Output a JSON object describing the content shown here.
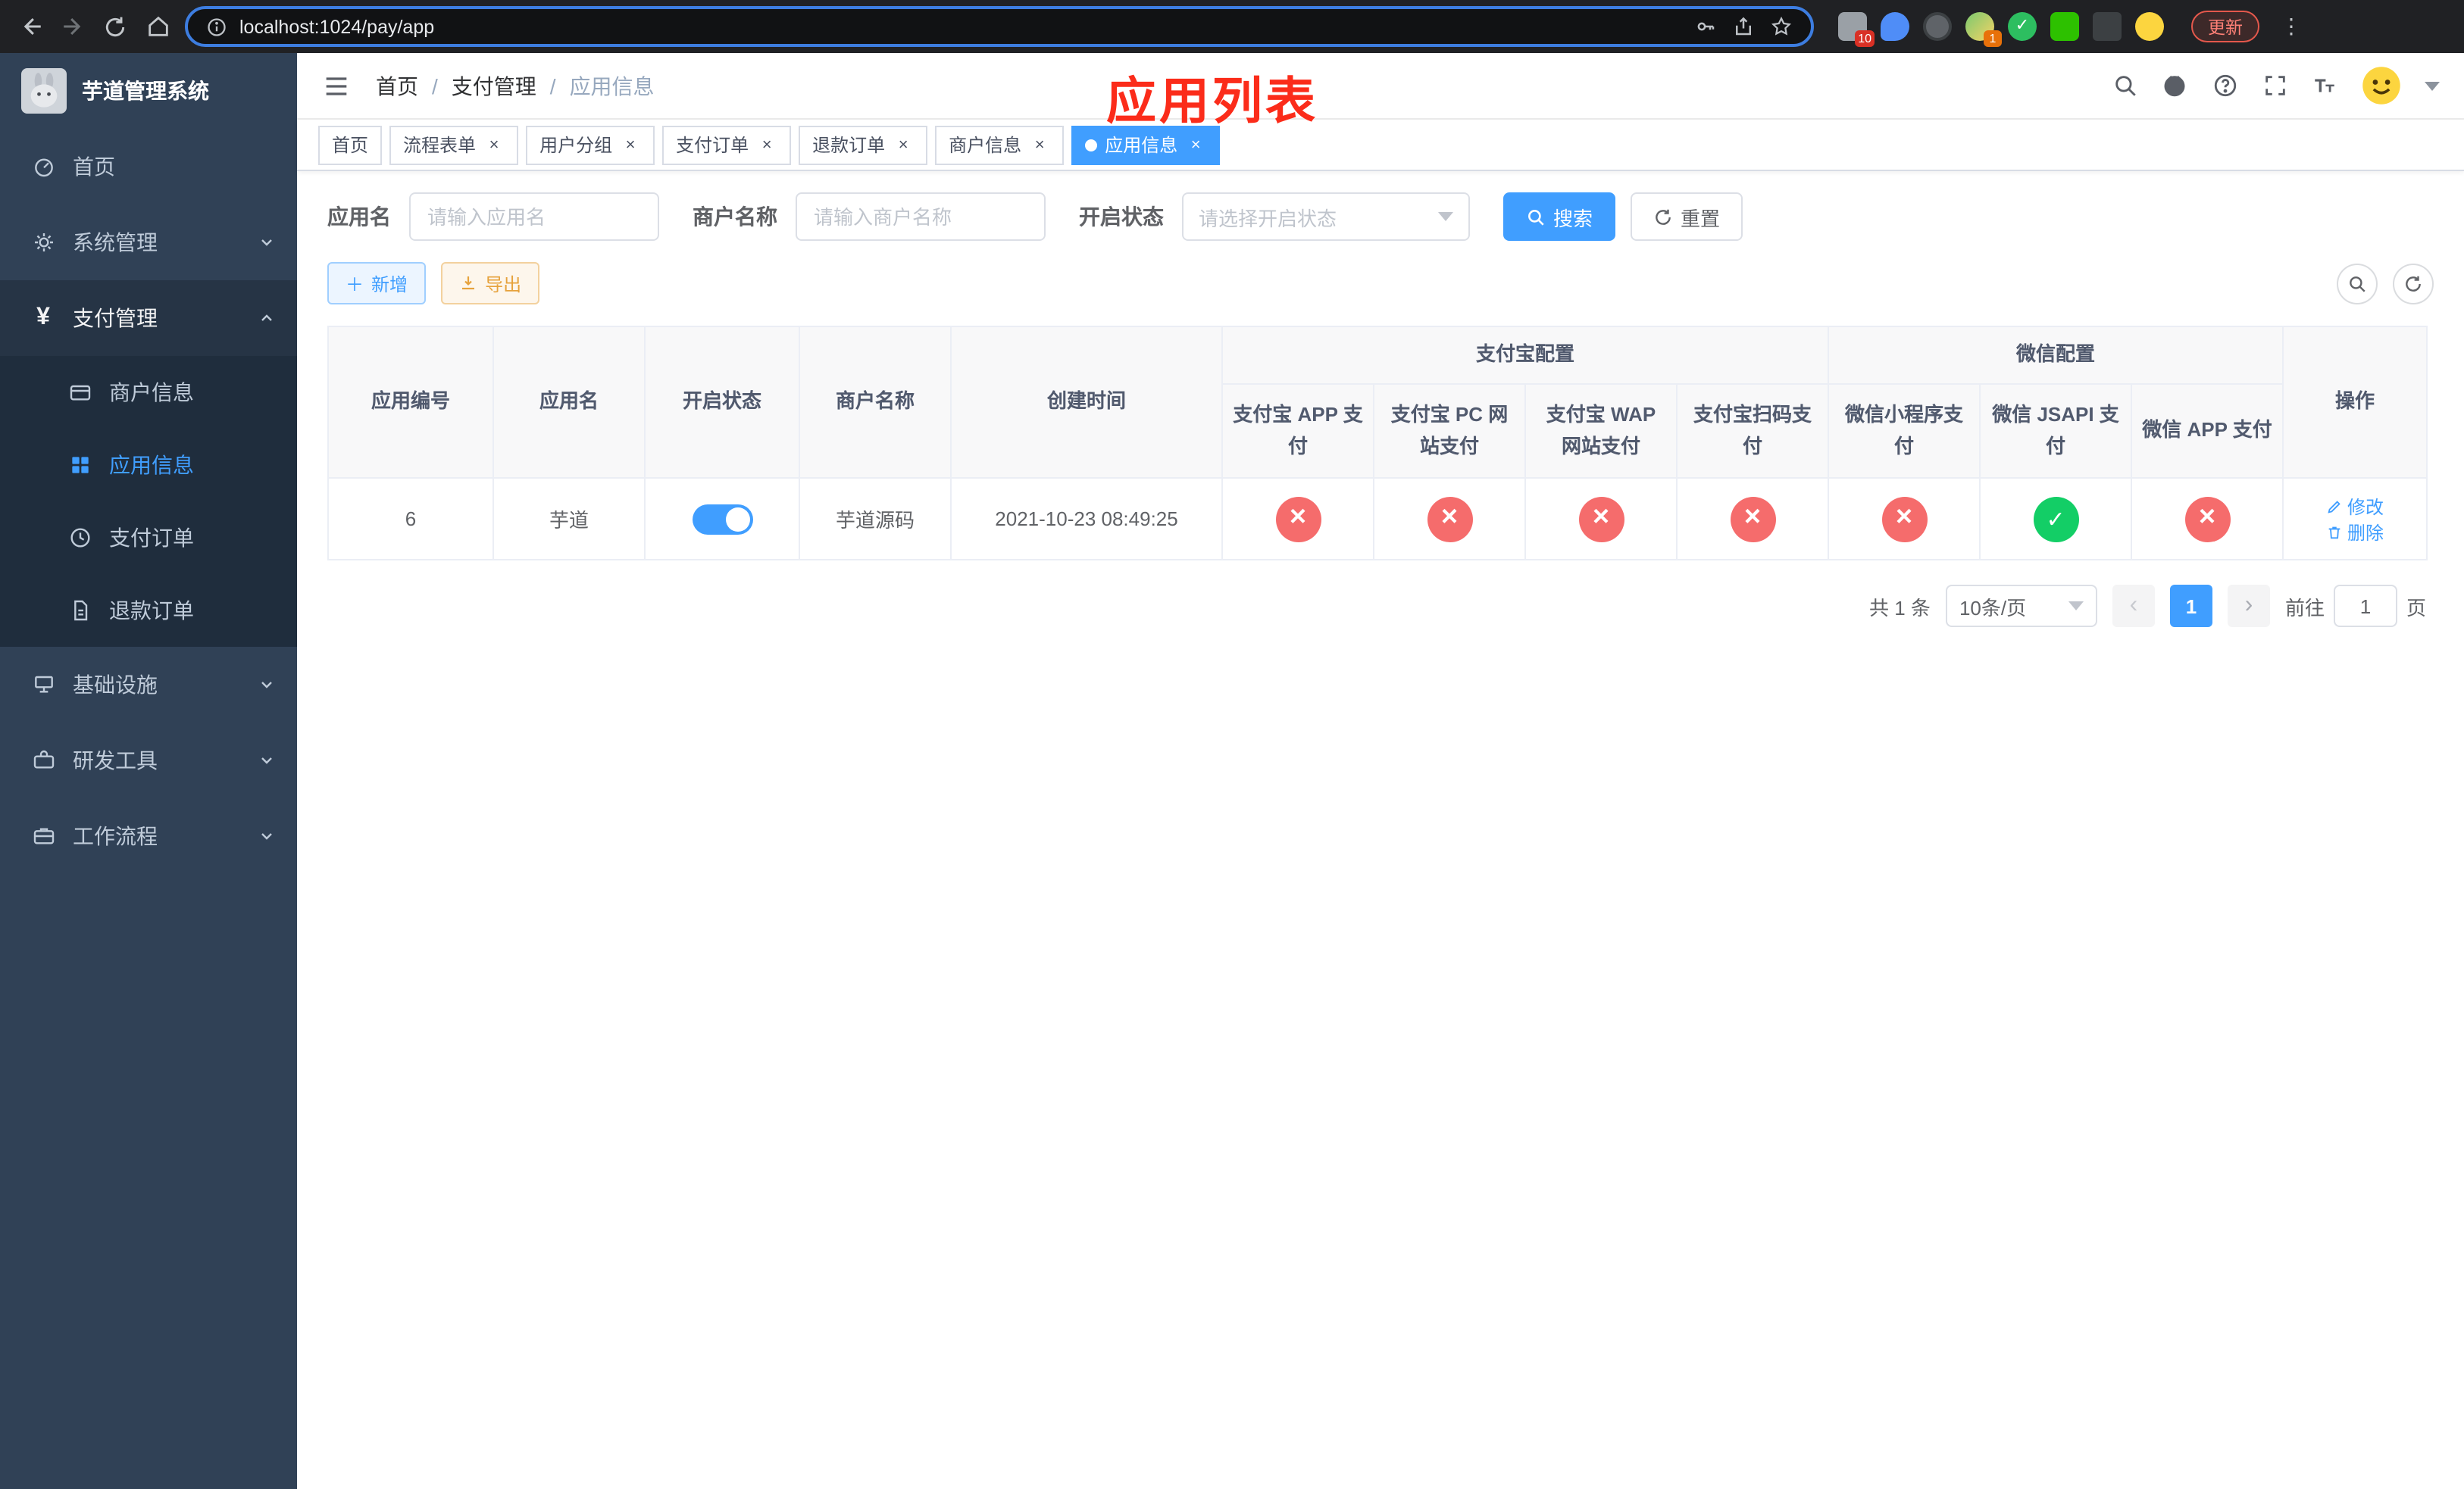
{
  "colors": {
    "primary": "#409eff",
    "success": "#13ce66",
    "danger": "#f56c6c",
    "warning": "#e6a23c",
    "sidebar_bg": "#304156",
    "submenu_bg": "#1f2d3d",
    "annotation_red": "#fb2c1a"
  },
  "browser": {
    "url": "localhost:1024/pay/app",
    "update_label": "更新",
    "ext_badge_a": "10",
    "ext_badge_b": "1"
  },
  "sidebar": {
    "title": "芋道管理系统",
    "home": "首页",
    "system": "系统管理",
    "payment": "支付管理",
    "payment_children": [
      "商户信息",
      "应用信息",
      "支付订单",
      "退款订单"
    ],
    "infra": "基础设施",
    "devtools": "研发工具",
    "workflow": "工作流程"
  },
  "header": {
    "breadcrumb": [
      "首页",
      "支付管理",
      "应用信息"
    ],
    "overlay_title": "应用列表"
  },
  "tabs": [
    "首页",
    "流程表单",
    "用户分组",
    "支付订单",
    "退款订单",
    "商户信息",
    "应用信息"
  ],
  "filters": {
    "app_name_label": "应用名",
    "app_name_placeholder": "请输入应用名",
    "merchant_label": "商户名称",
    "merchant_placeholder": "请输入商户名称",
    "status_label": "开启状态",
    "status_placeholder": "请选择开启状态",
    "search_label": "搜索",
    "reset_label": "重置"
  },
  "toolbar": {
    "add_label": "新增",
    "export_label": "导出"
  },
  "table": {
    "col_app_id": "应用编号",
    "col_app_name": "应用名",
    "col_status": "开启状态",
    "col_merchant": "商户名称",
    "col_created": "创建时间",
    "group_alipay": "支付宝配置",
    "group_wechat": "微信配置",
    "sub_cols": [
      "支付宝 APP 支付",
      "支付宝 PC 网站支付",
      "支付宝 WAP 网站支付",
      "支付宝扫码支付",
      "微信小程序支付",
      "微信 JSAPI 支付",
      "微信 APP 支付"
    ],
    "col_actions": "操作"
  },
  "row": {
    "id": "6",
    "name": "芋道",
    "merchant": "芋道源码",
    "created": "2021-10-23 08:49:25",
    "statuses": [
      "no",
      "no",
      "no",
      "no",
      "no",
      "yes",
      "no"
    ],
    "edit_label": "修改",
    "delete_label": "删除"
  },
  "pagination": {
    "total": "共 1 条",
    "page_size": "10条/页",
    "page": "1",
    "goto_prefix": "前往",
    "goto_value": "1",
    "goto_suffix": "页"
  }
}
